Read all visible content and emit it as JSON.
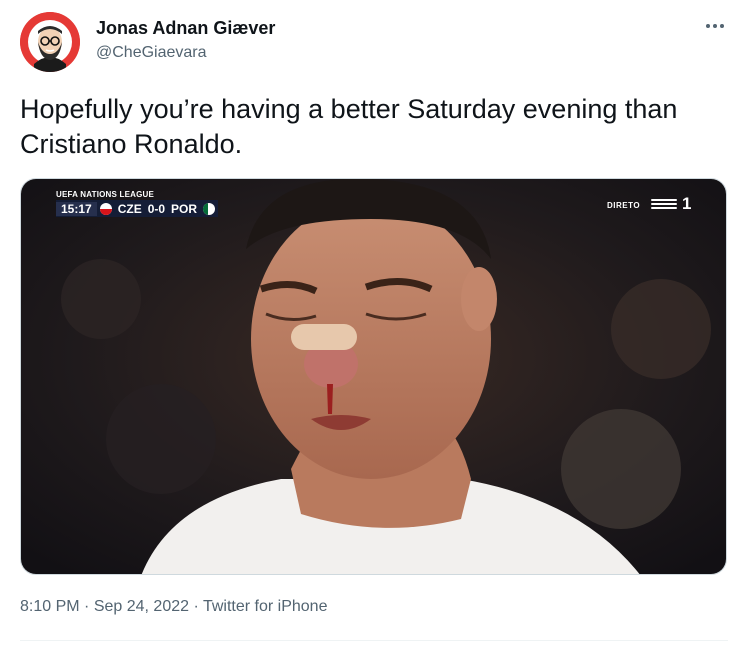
{
  "tweet": {
    "author": {
      "name": "Jonas Adnan Giæver",
      "handle": "@CheGiaevara",
      "avatar_icon": "avatar-cartoon-bearded-man-glasses",
      "avatar_bg": "#e53935"
    },
    "more_icon": "more-horizontal-icon",
    "text": "Hopefully you’re having a better Saturday evening than Cristiano Ronaldo.",
    "media": {
      "overlay": {
        "league": "UEFA NATIONS LEAGUE",
        "time": "15:17",
        "home": "CZE",
        "score": "0-0",
        "away": "POR",
        "live_label": "DIRETO",
        "channel": "1"
      }
    },
    "meta": {
      "time": "8:10 PM",
      "separator": "·",
      "date": "Sep 24, 2022",
      "source": "Twitter for iPhone"
    }
  }
}
